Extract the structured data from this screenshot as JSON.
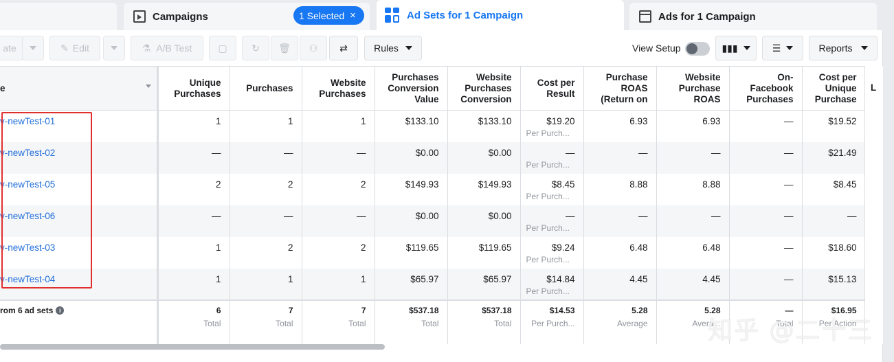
{
  "tabs": [
    {
      "label": "Campaigns",
      "icon": "folder-icon"
    },
    {
      "label": "Ad Sets for 1 Campaign",
      "icon": "grid-icon"
    },
    {
      "label": "Ads for 1 Campaign",
      "icon": "ad-window-icon"
    }
  ],
  "selected_pill": {
    "label": "1 Selected",
    "close": "×"
  },
  "toolbar": {
    "create_fragment": "ate",
    "edit_label": "Edit",
    "ab_test_label": "A/B Test",
    "rules_label": "Rules",
    "view_setup_label": "View Setup",
    "reports_label": "Reports"
  },
  "columns": {
    "name_fragment": "e",
    "headers": [
      "Unique Purchases",
      "Purchases",
      "Website Purchases",
      "Purchases Conversion Value",
      "Website Purchases Conversion",
      "Cost per Result",
      "Purchase ROAS (Return on",
      "Website Purchase ROAS",
      "On-Facebook Purchases",
      "Cost per Unique Purchase"
    ],
    "cut_header": "L"
  },
  "rows": [
    {
      "name": "v-newTest-01",
      "cells": [
        "1",
        "1",
        "1",
        "$133.10",
        "$133.10",
        "$19.20",
        "6.93",
        "6.93",
        "—",
        "$19.52"
      ],
      "cost_sub": "Per Purch..."
    },
    {
      "name": "v-newTest-02",
      "cells": [
        "—",
        "—",
        "—",
        "$0.00",
        "$0.00",
        "—",
        "—",
        "—",
        "—",
        "$21.49"
      ],
      "cost_sub": "Per Purch..."
    },
    {
      "name": "v-newTest-05",
      "cells": [
        "2",
        "2",
        "2",
        "$149.93",
        "$149.93",
        "$8.45",
        "8.88",
        "8.88",
        "—",
        "$8.45"
      ],
      "cost_sub": "Per Purch..."
    },
    {
      "name": "v-newTest-06",
      "cells": [
        "—",
        "—",
        "—",
        "$0.00",
        "$0.00",
        "—",
        "—",
        "—",
        "—",
        "—"
      ],
      "cost_sub": "Per Purch..."
    },
    {
      "name": "v-newTest-03",
      "cells": [
        "1",
        "2",
        "2",
        "$119.65",
        "$119.65",
        "$9.24",
        "6.48",
        "6.48",
        "—",
        "$18.60"
      ],
      "cost_sub": "Per Purch..."
    },
    {
      "name": "v-newTest-04",
      "cells": [
        "1",
        "1",
        "1",
        "$65.97",
        "$65.97",
        "$14.84",
        "4.45",
        "4.45",
        "—",
        "$15.13"
      ],
      "cost_sub": "Per Purch..."
    }
  ],
  "total": {
    "label": "rom 6 ad sets",
    "cells": [
      "6",
      "7",
      "7",
      "$537.18",
      "$537.18",
      "$14.53",
      "5.28",
      "5.28",
      "—",
      "$16.95"
    ],
    "subs": [
      "Total",
      "Total",
      "Total",
      "Total",
      "Total",
      "Per Purch...",
      "Average",
      "Avera...",
      "Total",
      "Per Action"
    ]
  },
  "watermark": "知乎 @二十三",
  "colors": {
    "accent": "#1877f2",
    "link": "#216fdb",
    "highlight": "#e0302e"
  }
}
